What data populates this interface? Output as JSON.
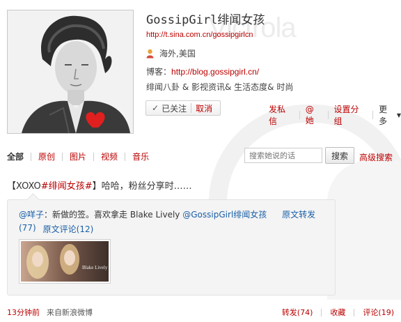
{
  "background_word": "Victrola",
  "profile": {
    "name": "GossipGirl绯闻女孩",
    "url": "http://t.sina.com.cn/gossipgirlcn",
    "location": "海外,美国",
    "blog_label": "博客：",
    "blog_url": "http://blog.gossipgirl.cn/",
    "tags": "绯闻八卦 & 影视资讯& 生活态度& 时尚",
    "follow_check": "✓",
    "followed_label": "已关注",
    "cancel_follow_label": "取消"
  },
  "actions": {
    "message": "发私信",
    "mention": "@她",
    "set_group": "设置分组",
    "more": "更多"
  },
  "tabs": [
    "全部",
    "原创",
    "图片",
    "视频",
    "音乐"
  ],
  "search": {
    "placeholder": "搜索她说的话",
    "button": "搜索",
    "advanced": "高级搜索"
  },
  "post": {
    "prefix": "【XOXO",
    "topic": "#绯闻女孩#",
    "suffix": "】哈哈，粉丝分享时……",
    "quote": {
      "user": "@咩子",
      "text": "：新做的签。喜欢拿走  Blake Lively ",
      "mention": "@GossipGirl绯闻女孩",
      "orig_forward": "原文转发",
      "forward_count": "(77)",
      "orig_comment": "原文评论(12)",
      "thumbnail_caption": "Blake Lively"
    },
    "time": "13分钟前",
    "source": "来自新浪微博",
    "forward": "转发(74)",
    "favorite": "收藏",
    "comment": "评论(19)"
  },
  "colors": {
    "link_red": "#bb0000",
    "link_blue": "#1a5fa6",
    "quote_bg": "#f4f4f4"
  }
}
